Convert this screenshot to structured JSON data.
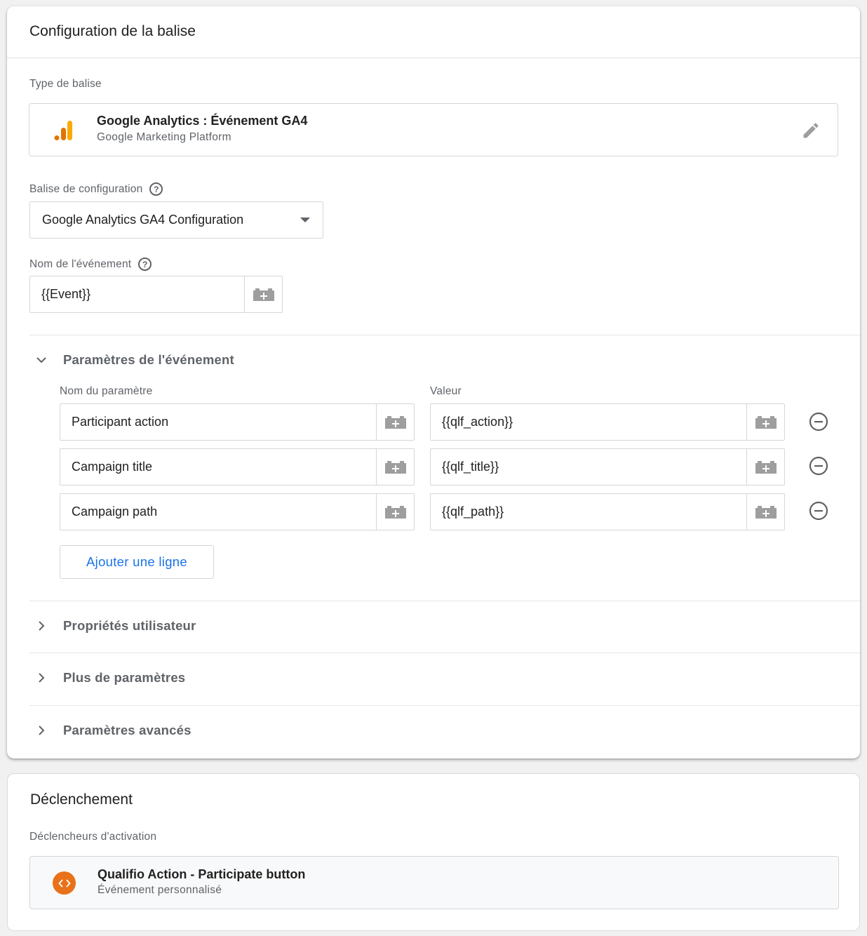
{
  "tag_config": {
    "title": "Configuration de la balise",
    "tag_type_label": "Type de balise",
    "tag_type": {
      "name": "Google Analytics : Événement GA4",
      "provider": "Google Marketing Platform",
      "icon": "google-analytics-icon",
      "edit_icon": "pencil-icon"
    },
    "config_tag_label": "Balise de configuration",
    "config_tag_value": "Google Analytics GA4 Configuration",
    "event_name_label": "Nom de l'événement",
    "event_name_value": "{{Event}}",
    "event_params": {
      "title": "Paramètres de l'événement",
      "expanded": true,
      "col_name": "Nom du paramètre",
      "col_value": "Valeur",
      "rows": [
        {
          "name": "Participant action",
          "value": "{{qlf_action}}"
        },
        {
          "name": "Campaign title",
          "value": "{{qlf_title}}"
        },
        {
          "name": "Campaign path",
          "value": "{{qlf_path}}"
        }
      ],
      "add_row_label": "Ajouter une ligne"
    },
    "collapsed_sections": [
      "Propriétés utilisateur",
      "Plus de paramètres",
      "Paramètres avancés"
    ]
  },
  "triggering": {
    "title": "Déclenchement",
    "triggers_label": "Déclencheurs d'activation",
    "trigger": {
      "name": "Qualifio Action - Participate button",
      "type": "Événement personnalisé",
      "icon": "custom-event-icon",
      "icon_color": "#e8711a"
    }
  },
  "colors": {
    "accent": "#1a73e8",
    "analytics_orange": "#f9ab00",
    "analytics_dark_orange": "#e37400"
  }
}
